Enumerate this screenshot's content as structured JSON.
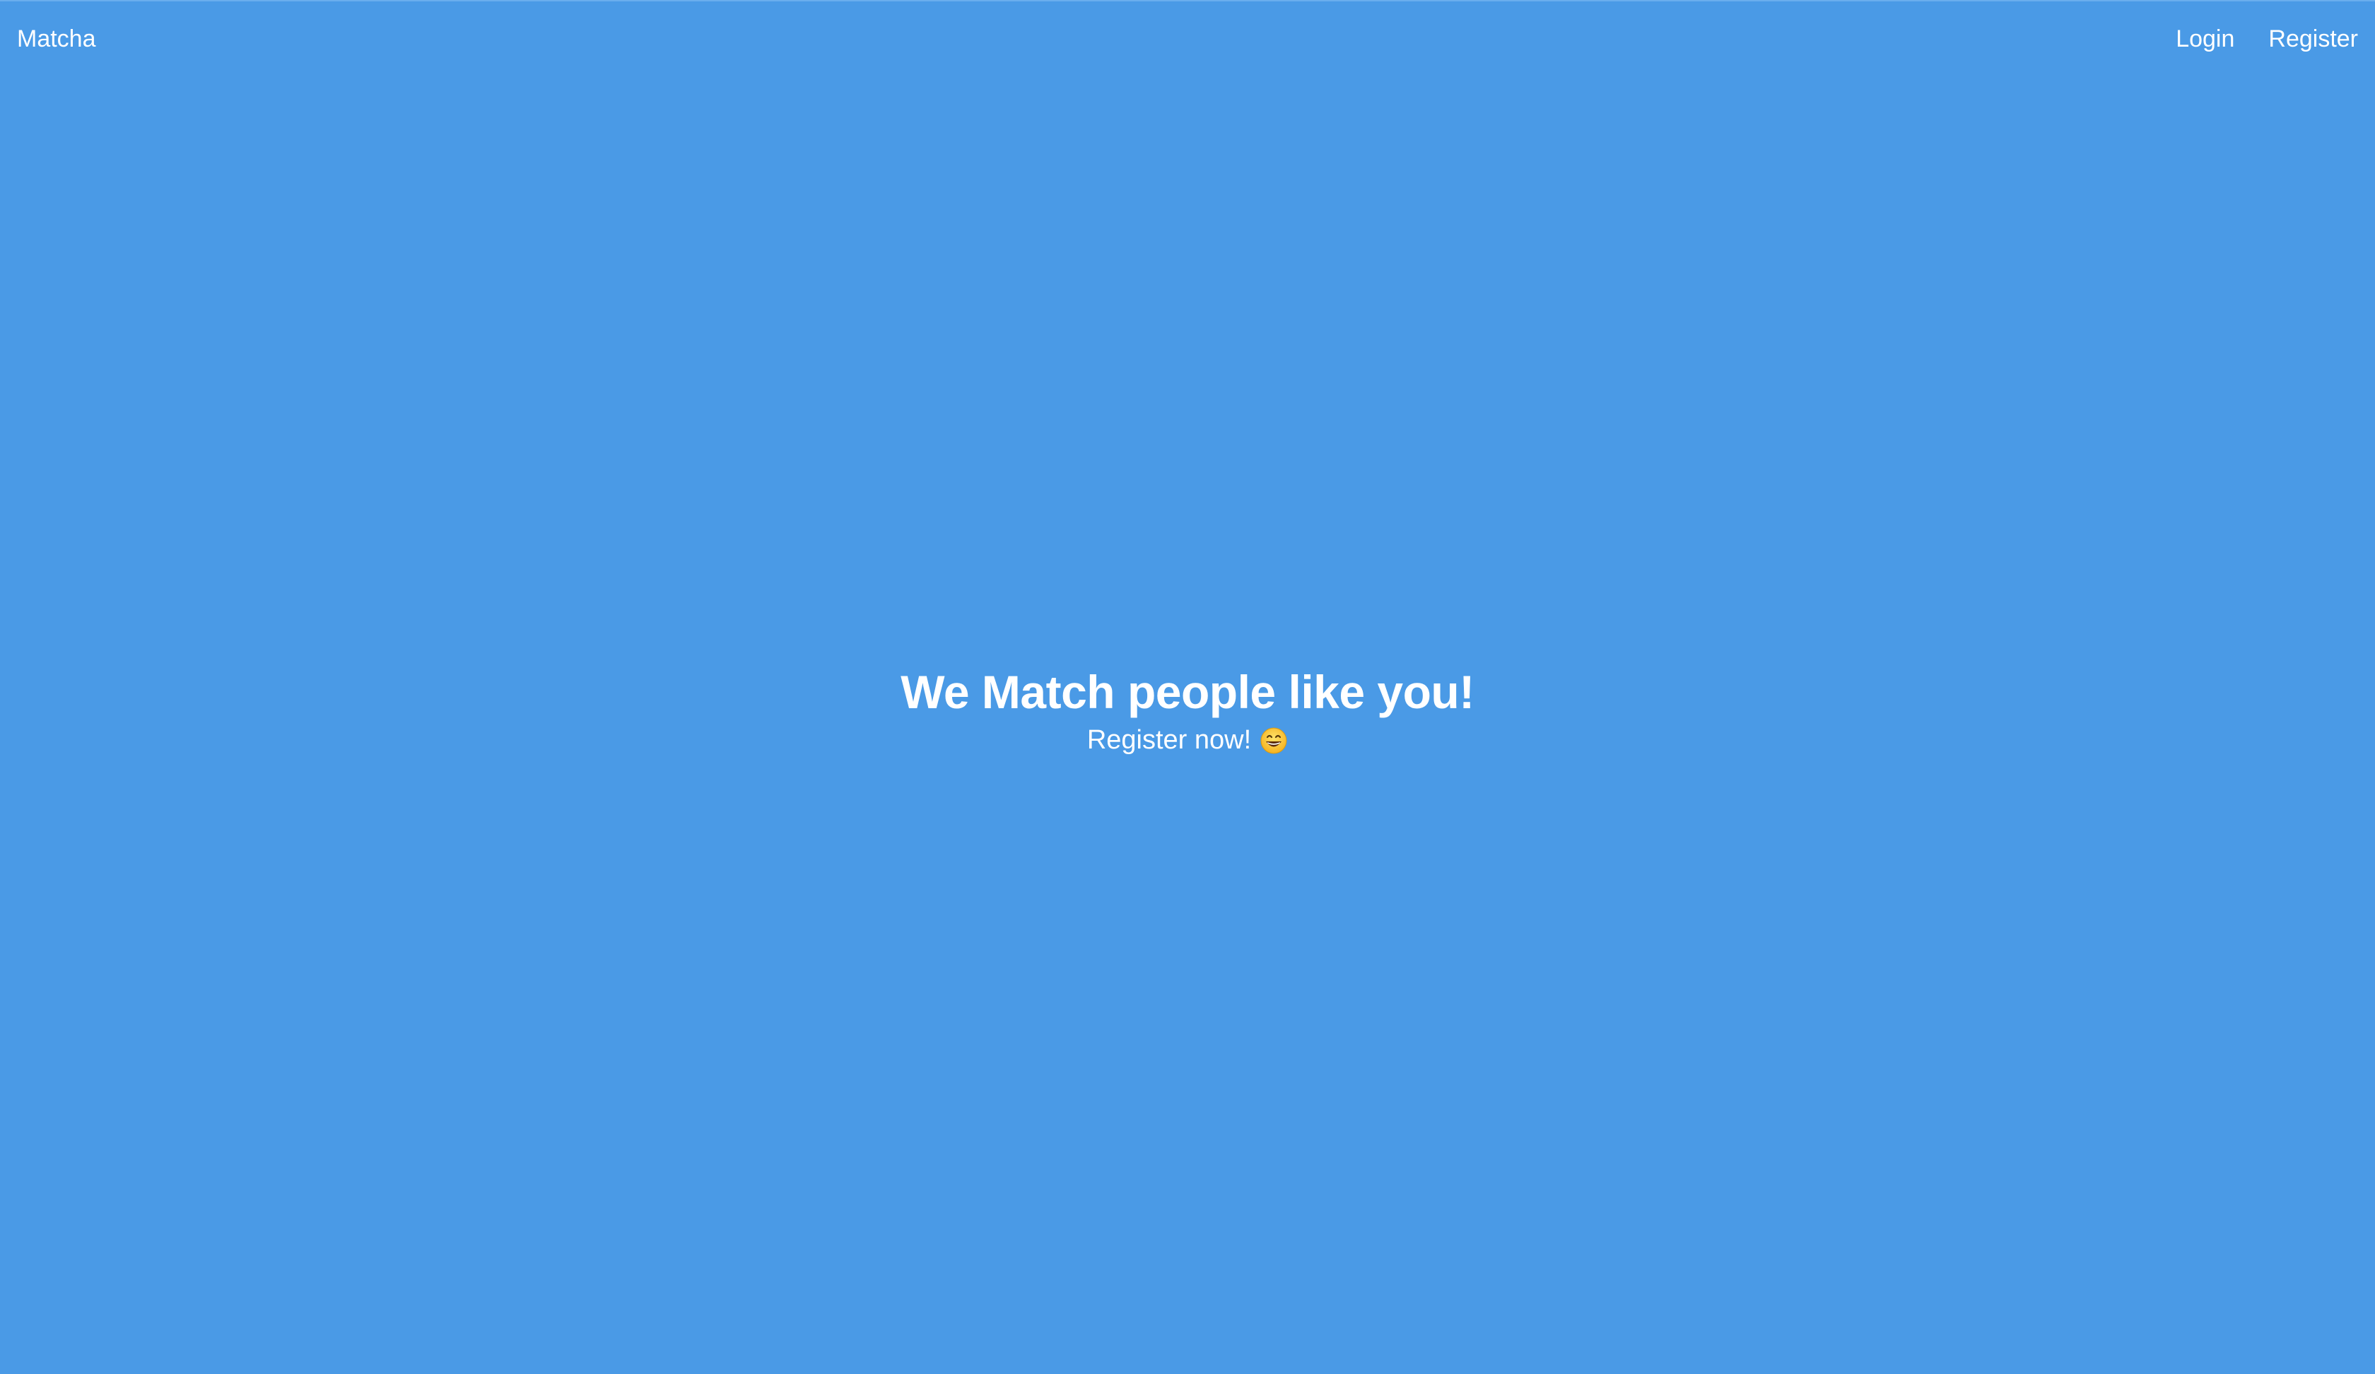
{
  "navbar": {
    "brand": "Matcha",
    "links": [
      {
        "label": "Login"
      },
      {
        "label": "Register"
      }
    ]
  },
  "hero": {
    "title": "We Match people like you!",
    "subtitle": "Register now!",
    "subtitle_icon": "grinning-face-icon"
  },
  "colors": {
    "background": "#4a9ae6",
    "text": "#ffffff"
  }
}
